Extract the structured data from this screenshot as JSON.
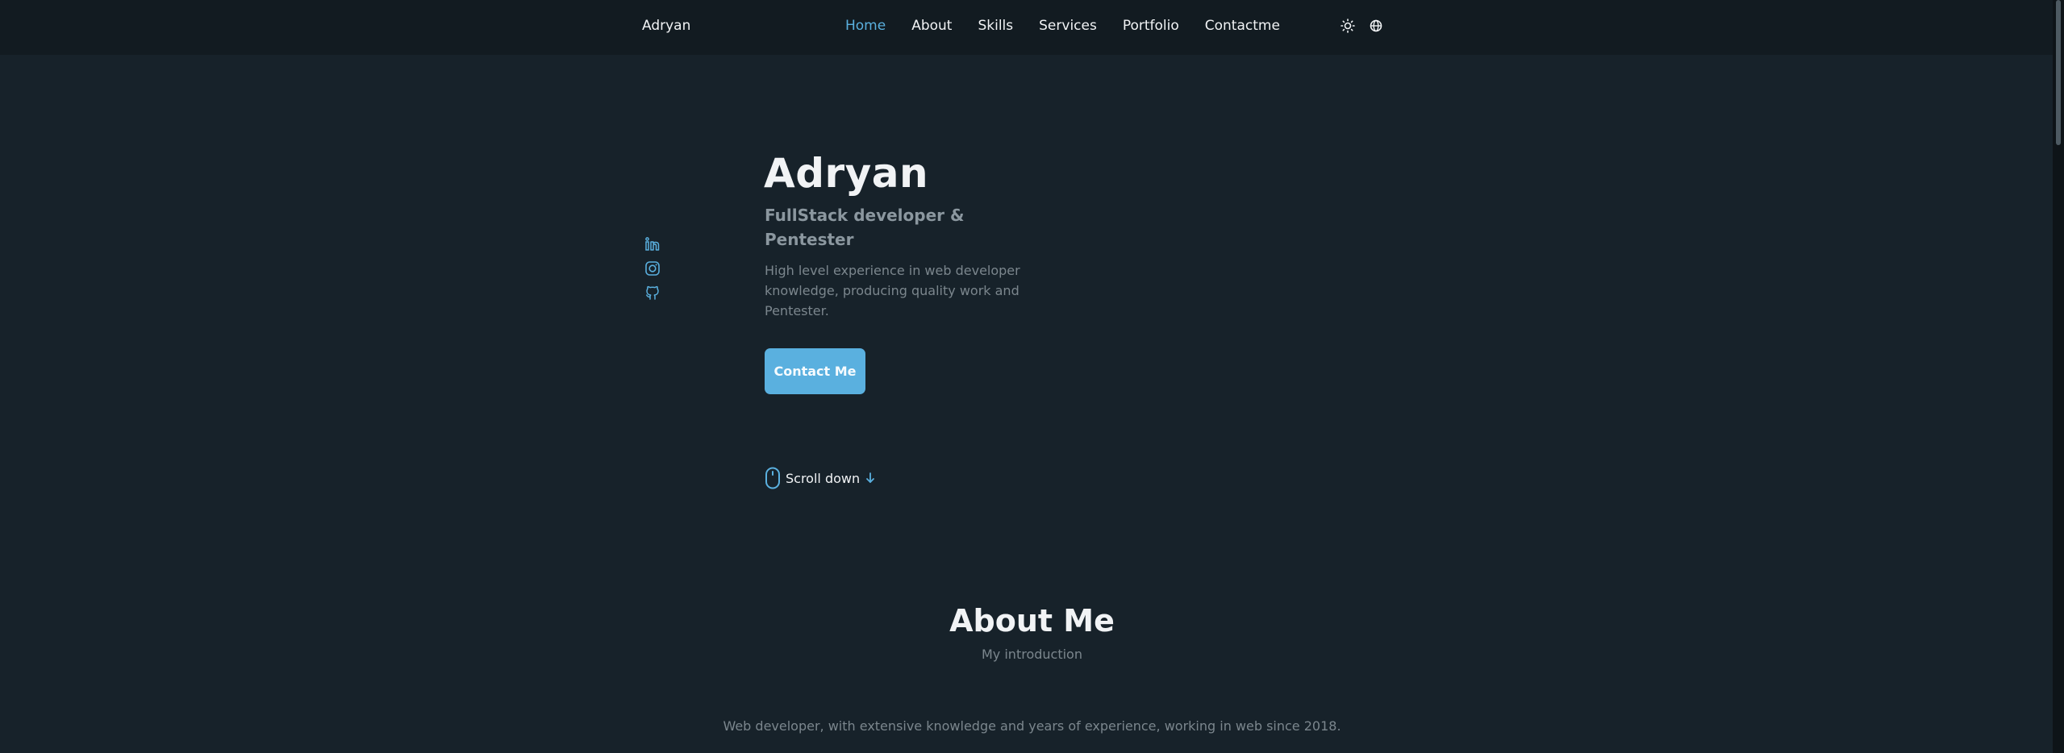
{
  "navbar": {
    "brand": "Adryan",
    "links": [
      "Home",
      "About",
      "Skills",
      "Services",
      "Portfolio",
      "Contactme"
    ],
    "active": "Home",
    "theme_icon": "sun-icon",
    "language_icon": "globe-icon"
  },
  "socials": {
    "icons": [
      "linkedin-icon",
      "instagram-icon",
      "github-icon"
    ]
  },
  "hero": {
    "name": "Adryan",
    "subtitle": "FullStack developer & Pentester",
    "description": "High level experience in web developer knowledge, producing quality work and Pentester.",
    "button": "Contact Me",
    "scroll_label": "Scroll down",
    "scroll_icons": [
      "mouse-icon",
      "arrow-down-icon"
    ]
  },
  "about": {
    "title": "About Me",
    "subtitle": "My introduction",
    "text": "Web developer, with extensive knowledge and years of experience, working in web since 2018."
  },
  "colors": {
    "background": "#17222a",
    "navbar": "#121b21",
    "accent": "#5ab0df",
    "text": "#f1f3f5",
    "muted": "#7b868d"
  }
}
